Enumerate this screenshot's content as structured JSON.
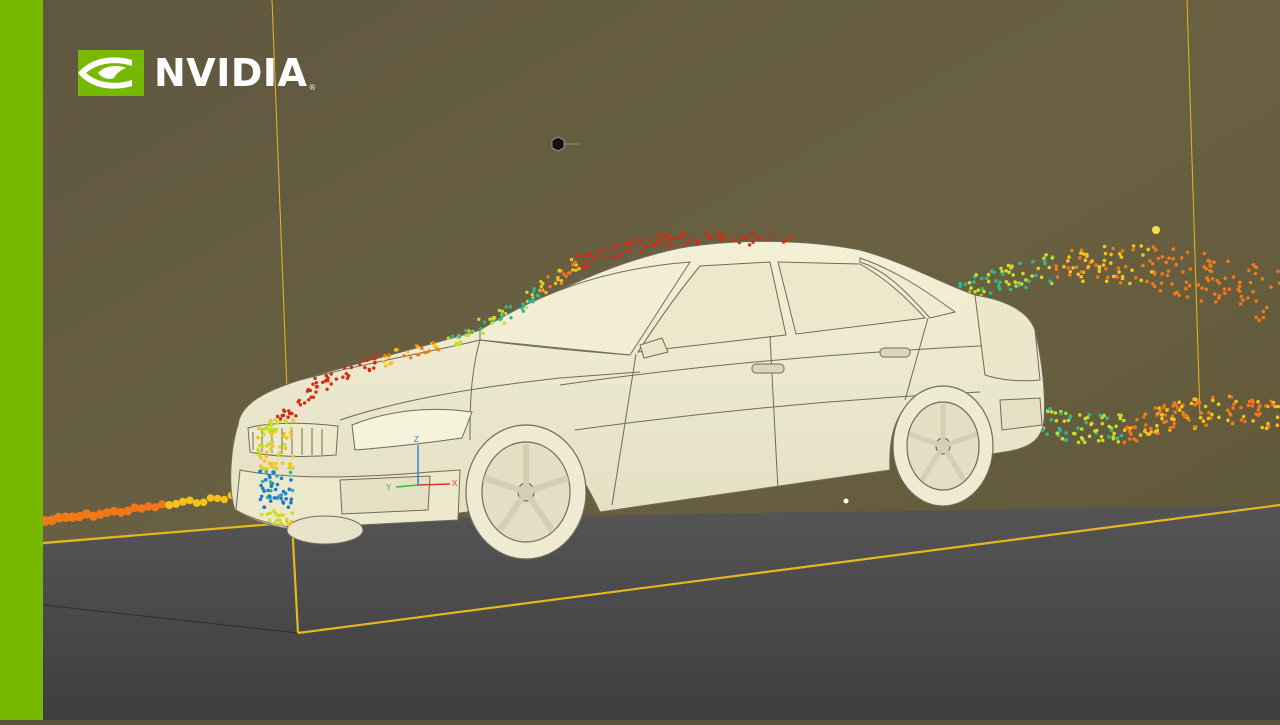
{
  "brand": {
    "logo_text": "NVIDIA",
    "registered_mark": "®",
    "accent_color": "#76b900",
    "logo_icon": "nvidia-eye-icon"
  },
  "scene": {
    "type": "cfd-particle-flow-visualization",
    "object": "sedan-car-wireframe",
    "background_color": "#5c5439",
    "floor_color": "#4a4a4a",
    "domain_outline_color": "#e6b81e",
    "particle_colors": [
      "#d62a12",
      "#f07818",
      "#f4c21a",
      "#c8dc28",
      "#2fb890",
      "#1f78d0"
    ]
  },
  "gizmo": {
    "axis_z": "Z",
    "axis_y": "Y",
    "axis_x": "X"
  }
}
